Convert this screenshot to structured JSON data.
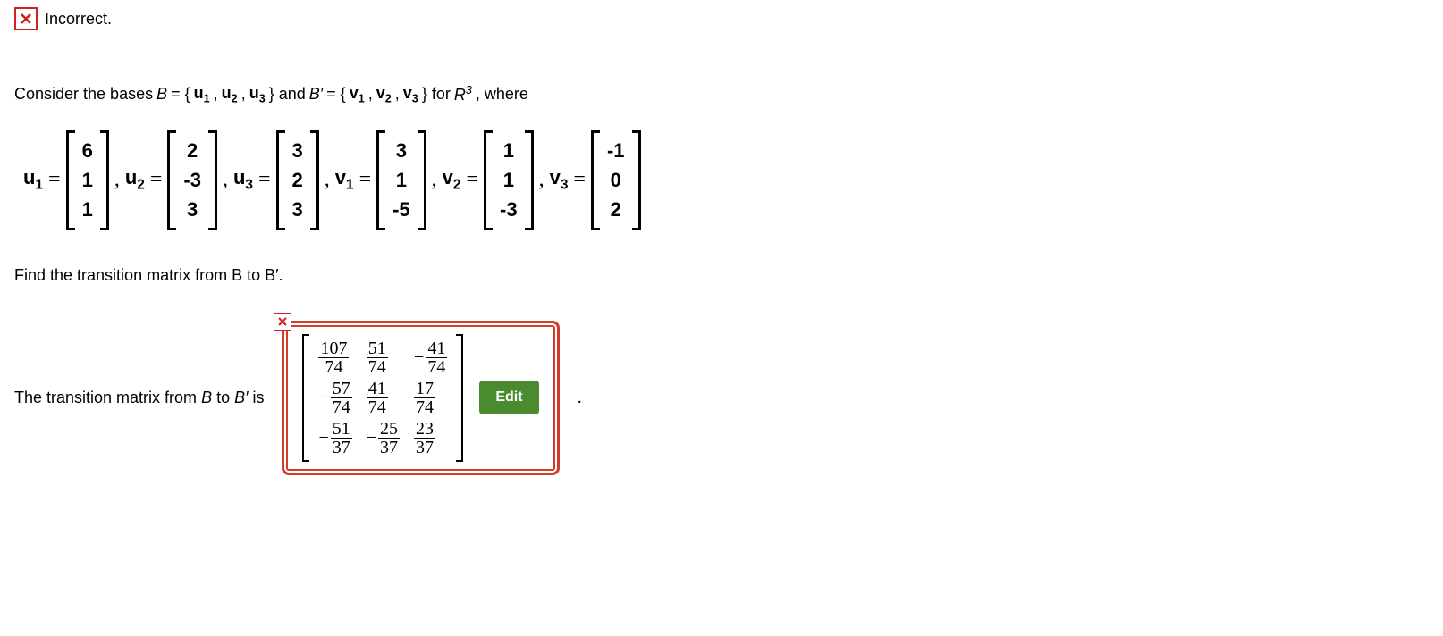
{
  "status": {
    "icon_label": "x",
    "text": "Incorrect."
  },
  "prompt": {
    "pre": "Consider the bases ",
    "B": "B",
    "eq": " = {",
    "u1": "u",
    "s1": "1",
    "c1": ",",
    "u2": "u",
    "s2": "2",
    "c2": ",",
    "u3": "u",
    "s3": "3",
    "close1": "} and ",
    "Bp": "B′",
    "eq2": " = {",
    "v1": "v",
    "vs1": "1",
    "vc1": ",",
    "v2": "v",
    "vs2": "2",
    "vc2": ",",
    "v3": "v",
    "vs3": "3",
    "close2": "} for ",
    "R": "R",
    "exp": "3",
    "post": ", where"
  },
  "vectors": {
    "u1_label": "u",
    "u1_sub": "1",
    "u1": [
      "6",
      "1",
      "1"
    ],
    "u2_label": "u",
    "u2_sub": "2",
    "u2": [
      "2",
      "-3",
      "3"
    ],
    "u3_label": "u",
    "u3_sub": "3",
    "u3": [
      "3",
      "2",
      "3"
    ],
    "v1_label": "v",
    "v1_sub": "1",
    "v1": [
      "3",
      "1",
      "-5"
    ],
    "v2_label": "v",
    "v2_sub": "2",
    "v2": [
      "1",
      "1",
      "-3"
    ],
    "v3_label": "v",
    "v3_sub": "3",
    "v3": [
      "-1",
      "0",
      "2"
    ]
  },
  "instruction": "Find the transition matrix from B to B′.",
  "answer": {
    "lead_pre": "The transition matrix from ",
    "lead_B": "B",
    "lead_mid": " to ",
    "lead_Bp": "B′",
    "lead_post": " is",
    "small_x": "×",
    "matrix": [
      [
        {
          "neg": false,
          "num": "107",
          "den": "74"
        },
        {
          "neg": false,
          "num": "51",
          "den": "74"
        },
        {
          "neg": true,
          "num": "41",
          "den": "74"
        }
      ],
      [
        {
          "neg": true,
          "num": "57",
          "den": "74"
        },
        {
          "neg": false,
          "num": "41",
          "den": "74"
        },
        {
          "neg": false,
          "num": "17",
          "den": "74"
        }
      ],
      [
        {
          "neg": true,
          "num": "51",
          "den": "37"
        },
        {
          "neg": true,
          "num": "25",
          "den": "37"
        },
        {
          "neg": false,
          "num": "23",
          "den": "37"
        }
      ]
    ],
    "edit_label": "Edit",
    "period": "."
  }
}
